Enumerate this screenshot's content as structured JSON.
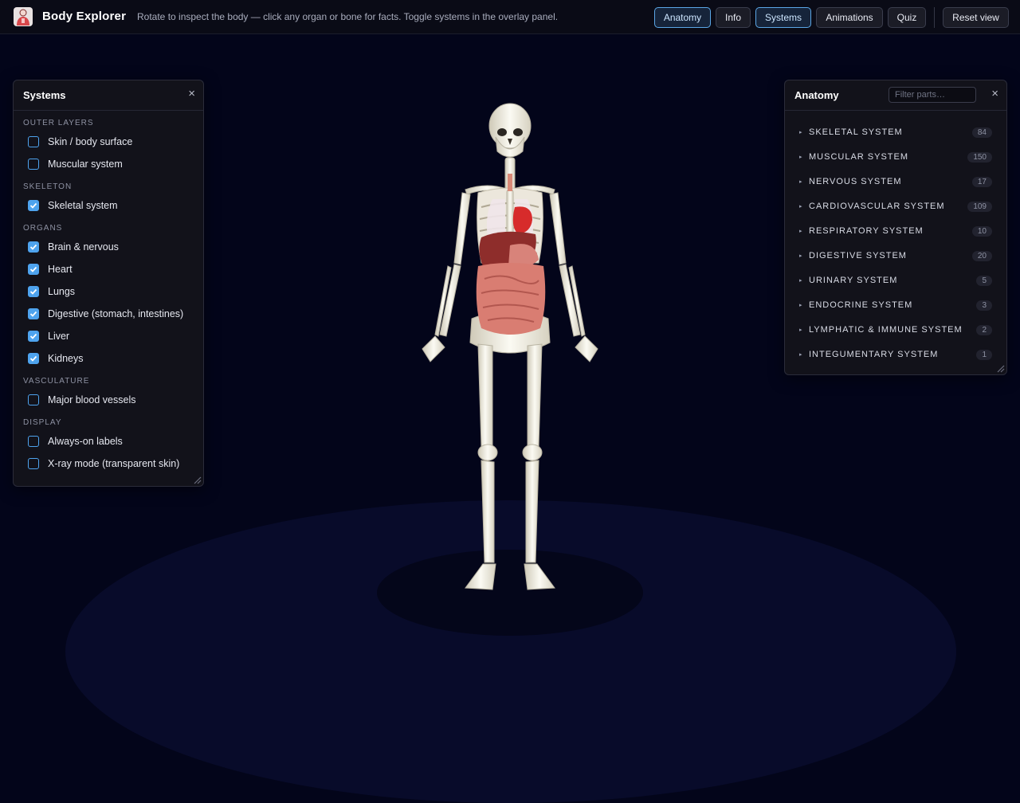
{
  "app": {
    "title": "Body Explorer",
    "subtitle": "Rotate to inspect the body — click any organ or bone for facts. Toggle systems in the overlay panel.",
    "logo_icon": "human-body-icon"
  },
  "toolbar": {
    "buttons": [
      {
        "label": "Anatomy",
        "active": true
      },
      {
        "label": "Info",
        "active": false
      },
      {
        "label": "Systems",
        "active": true
      },
      {
        "label": "Animations",
        "active": false
      },
      {
        "label": "Quiz",
        "active": false
      }
    ],
    "reset_label": "Reset view"
  },
  "systems_panel": {
    "title": "Systems",
    "close_label": "×",
    "groups": [
      {
        "name": "Outer layers",
        "items": [
          {
            "label": "Skin / body surface",
            "checked": false
          },
          {
            "label": "Muscular system",
            "checked": false
          }
        ]
      },
      {
        "name": "Skeleton",
        "items": [
          {
            "label": "Skeletal system",
            "checked": true
          }
        ]
      },
      {
        "name": "Organs",
        "items": [
          {
            "label": "Brain & nervous",
            "checked": true
          },
          {
            "label": "Heart",
            "checked": true
          },
          {
            "label": "Lungs",
            "checked": true
          },
          {
            "label": "Digestive (stomach, intestines)",
            "checked": true
          },
          {
            "label": "Liver",
            "checked": true
          },
          {
            "label": "Kidneys",
            "checked": true
          }
        ]
      },
      {
        "name": "Vasculature",
        "items": [
          {
            "label": "Major blood vessels",
            "checked": false
          }
        ]
      },
      {
        "name": "Display",
        "items": [
          {
            "label": "Always-on labels",
            "checked": false
          },
          {
            "label": "X-ray mode (transparent skin)",
            "checked": false
          }
        ]
      }
    ]
  },
  "anatomy_panel": {
    "title": "Anatomy",
    "filter_placeholder": "Filter parts…",
    "close_label": "×",
    "systems": [
      {
        "label": "SKELETAL SYSTEM",
        "count": "84"
      },
      {
        "label": "MUSCULAR SYSTEM",
        "count": "150"
      },
      {
        "label": "NERVOUS SYSTEM",
        "count": "17"
      },
      {
        "label": "CARDIOVASCULAR SYSTEM",
        "count": "109"
      },
      {
        "label": "RESPIRATORY SYSTEM",
        "count": "10"
      },
      {
        "label": "DIGESTIVE SYSTEM",
        "count": "20"
      },
      {
        "label": "URINARY SYSTEM",
        "count": "5"
      },
      {
        "label": "ENDOCRINE SYSTEM",
        "count": "3"
      },
      {
        "label": "LYMPHATIC & IMMUNE SYSTEM",
        "count": "2"
      },
      {
        "label": "INTEGUMENTARY SYSTEM",
        "count": "1"
      }
    ]
  },
  "colors": {
    "accent": "#4ea3ee",
    "background": "#03051a",
    "bone": "#f1efe6",
    "organ_red": "#c92a2a",
    "intestine": "#d97d72"
  }
}
